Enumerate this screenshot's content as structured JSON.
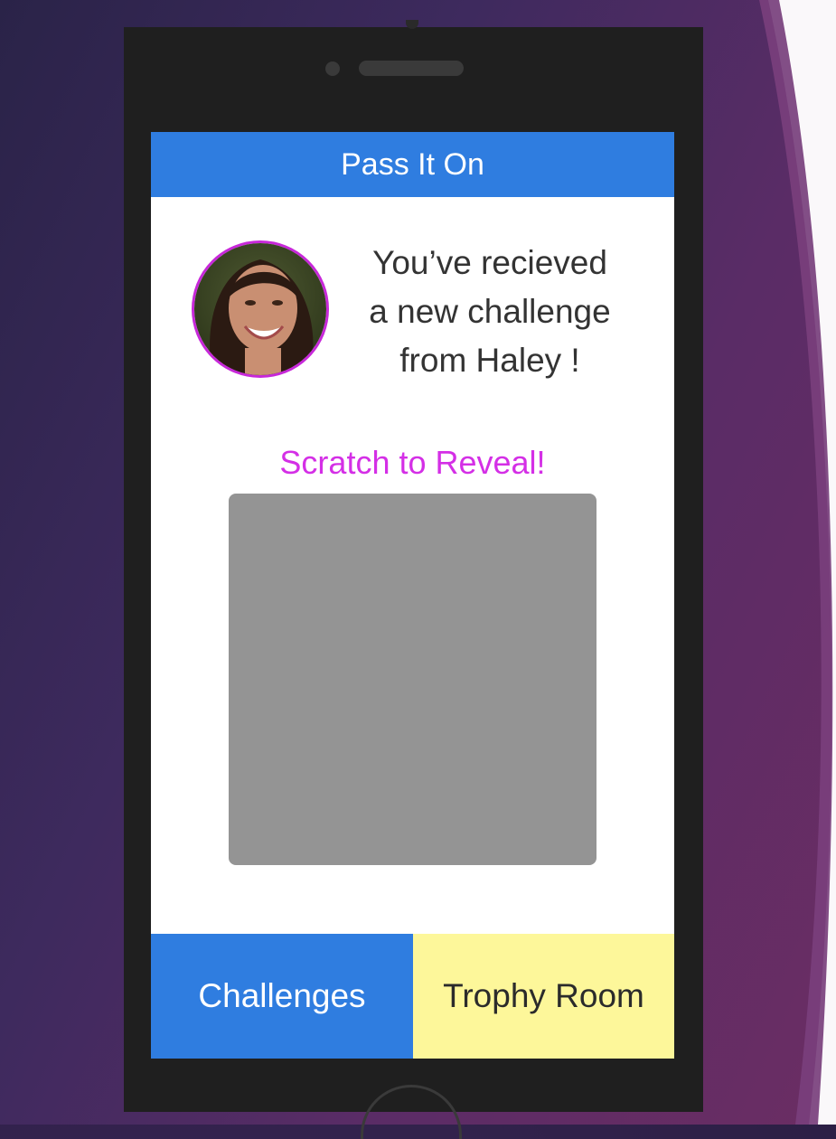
{
  "app": {
    "title": "Pass It On"
  },
  "challenge": {
    "message_line1": "You’ve recieved",
    "message_line2": "a new challenge",
    "message_line3": "from Haley !",
    "sender_avatar": "avatar-photo",
    "scratch_label": "Scratch to Reveal!"
  },
  "nav": {
    "challenges_label": "Challenges",
    "trophy_label": "Trophy Room"
  },
  "colors": {
    "header_blue": "#2f7de0",
    "accent_magenta": "#d42fe6",
    "trophy_yellow": "#fdf79a",
    "scratch_gray": "#949494"
  }
}
